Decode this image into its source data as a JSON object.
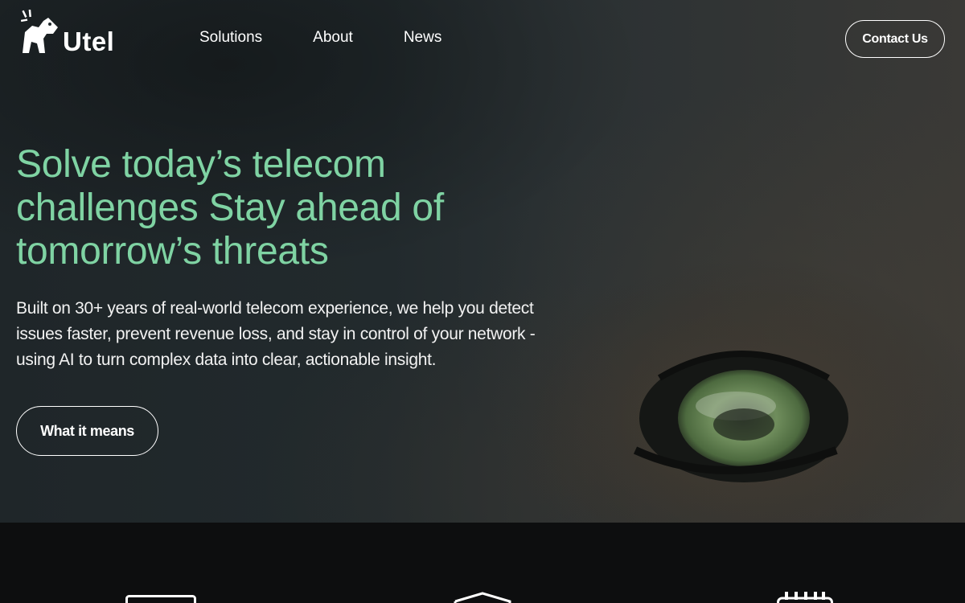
{
  "brand": {
    "name": "Utel"
  },
  "nav": {
    "items": [
      {
        "label": "Solutions"
      },
      {
        "label": "About"
      },
      {
        "label": "News"
      }
    ]
  },
  "header": {
    "contact_label": "Contact Us"
  },
  "hero": {
    "headline": "Solve today’s telecom challenges Stay ahead of tomorrow’s threats",
    "body": "Built on 30+ years of real-world telecom experience, we help you detect issues faster, prevent revenue loss, and stay in control of your network - using AI to turn complex data into clear, actionable insight.",
    "cta_label": "What it means"
  },
  "colors": {
    "accent": "#7fd3a3",
    "text": "#ffffff",
    "hero_bg": "#222a2d",
    "section_bg": "#0d0e0f"
  },
  "features": {
    "icons": [
      "monitor-icon",
      "shield-icon",
      "chip-icon"
    ]
  }
}
